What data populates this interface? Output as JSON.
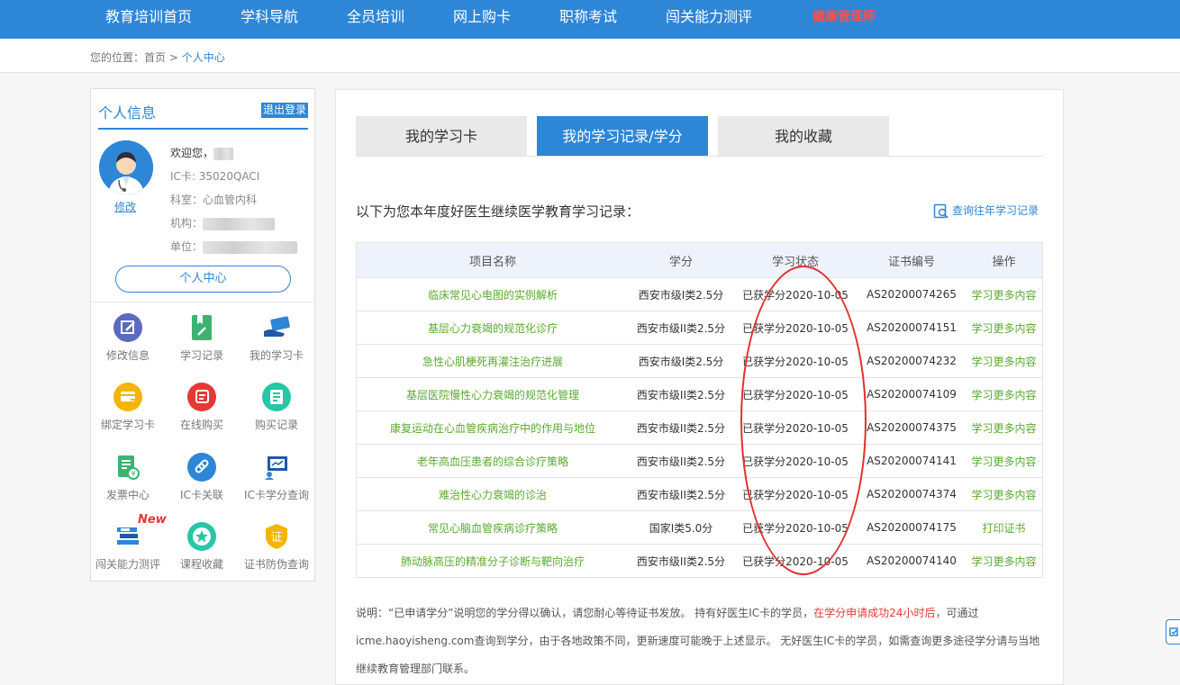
{
  "nav": {
    "items": [
      "教育培训首页",
      "学科导航",
      "全员培训",
      "网上购卡",
      "职称考试",
      "闯关能力测评"
    ],
    "hot_item": "健康管理师",
    "bg_color": "#2e86d6"
  },
  "breadcrumb": {
    "prefix": "您的位置：",
    "home": "首页",
    "sep": " > ",
    "current": "个人中心"
  },
  "sidebar": {
    "title": "个人信息",
    "logout": "退出登录",
    "edit": "修改",
    "welcome": "欢迎您，",
    "ic_card": "IC卡: 35020QACI",
    "dept": "科室：心血管内科",
    "org_label": "机构：",
    "unit_label": "单位：",
    "center_button": "个人中心",
    "grid": [
      {
        "label": "修改信息",
        "icon": "edit-icon",
        "color": "#5c6bc0"
      },
      {
        "label": "学习记录",
        "icon": "study-record-icon",
        "color": "#3cb371"
      },
      {
        "label": "我的学习卡",
        "icon": "card-hand-icon",
        "color": "#2e86d6"
      },
      {
        "label": "绑定学习卡",
        "icon": "bind-card-icon",
        "color": "#f5b400"
      },
      {
        "label": "在线购买",
        "icon": "cart-icon",
        "color": "#e53935"
      },
      {
        "label": "购买记录",
        "icon": "list-icon",
        "color": "#26c6a6"
      },
      {
        "label": "发票中心",
        "icon": "invoice-icon",
        "color": "#3cb371"
      },
      {
        "label": "IC卡关联",
        "icon": "link-icon",
        "color": "#2e86d6"
      },
      {
        "label": "IC卡学分查询",
        "icon": "board-icon",
        "color": "#1e5aa8"
      },
      {
        "label": "闯关能力测评",
        "icon": "books-icon",
        "color": "#2e86d6"
      },
      {
        "label": "课程收藏",
        "icon": "star-icon",
        "color": "#26c6a6"
      },
      {
        "label": "证书防伪查询",
        "icon": "certificate-icon",
        "color": "#f5b400"
      }
    ],
    "new_badge": "New"
  },
  "tabs": [
    {
      "label": "我的学习卡",
      "active": false
    },
    {
      "label": "我的学习记录/学分",
      "active": true
    },
    {
      "label": "我的收藏",
      "active": false
    }
  ],
  "main": {
    "intro": "以下为您本年度好医生继续医学教育学习记录：",
    "history_link": "查询往年学习记录",
    "columns": [
      "项目名称",
      "学分",
      "学习状态",
      "证书编号",
      "操作"
    ],
    "rows": [
      {
        "name": "临床常见心电图的实例解析",
        "credit": "西安市级I类2.5分",
        "status": "已获学分2020-10-05",
        "cert": "AS20200074265",
        "action": "学习更多内容"
      },
      {
        "name": "基层心力衰竭的规范化诊疗",
        "credit": "西安市级II类2.5分",
        "status": "已获学分2020-10-05",
        "cert": "AS20200074151",
        "action": "学习更多内容"
      },
      {
        "name": "急性心肌梗死再灌注治疗进展",
        "credit": "西安市级I类2.5分",
        "status": "已获学分2020-10-05",
        "cert": "AS20200074232",
        "action": "学习更多内容"
      },
      {
        "name": "基层医院慢性心力衰竭的规范化管理",
        "credit": "西安市级II类2.5分",
        "status": "已获学分2020-10-05",
        "cert": "AS20200074109",
        "action": "学习更多内容"
      },
      {
        "name": "康复运动在心血管疾病治疗中的作用与地位",
        "credit": "西安市级II类2.5分",
        "status": "已获学分2020-10-05",
        "cert": "AS20200074375",
        "action": "学习更多内容"
      },
      {
        "name": "老年高血压患者的综合诊疗策略",
        "credit": "西安市级II类2.5分",
        "status": "已获学分2020-10-05",
        "cert": "AS20200074141",
        "action": "学习更多内容"
      },
      {
        "name": "难治性心力衰竭的诊治",
        "credit": "西安市级II类2.5分",
        "status": "已获学分2020-10-05",
        "cert": "AS20200074374",
        "action": "学习更多内容"
      },
      {
        "name": "常见心脑血管疾病诊疗策略",
        "credit": "国家I类5.0分",
        "status": "已获学分2020-10-05",
        "cert": "AS20200074175",
        "action": "打印证书"
      },
      {
        "name": "肺动脉高压的精准分子诊断与靶向治疗",
        "credit": "西安市级II类2.5分",
        "status": "已获学分2020-10-05",
        "cert": "AS20200074140",
        "action": "学习更多内容"
      }
    ],
    "note_a": "说明：“已申请学分”说明您的学分得以确认，请您耐心等待证书发放。 持有好医生IC卡的学员，",
    "note_red": "在学分申请成功24小时后",
    "note_b": "，可通过icme.haoyisheng.com查询到学分，由于各地政策不同，更新速度可能晚于上述显示。 无好医生IC卡的学员，如需查询更多途径学分请与当地继续教育管理部门联系。"
  }
}
